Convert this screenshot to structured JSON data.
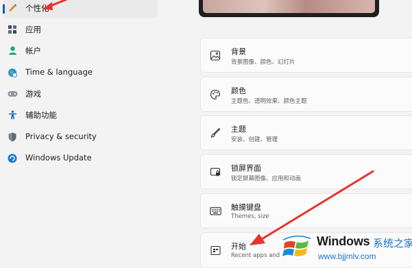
{
  "sidebar": {
    "items": [
      {
        "label": "个性化",
        "icon": "pencil-icon",
        "selected": true
      },
      {
        "label": "应用",
        "icon": "apps-icon"
      },
      {
        "label": "帐户",
        "icon": "person-icon"
      },
      {
        "label": "Time & language",
        "icon": "globe-clock-icon"
      },
      {
        "label": "游戏",
        "icon": "gamepad-icon"
      },
      {
        "label": "辅助功能",
        "icon": "accessibility-icon"
      },
      {
        "label": "Privacy & security",
        "icon": "shield-icon"
      },
      {
        "label": "Windows Update",
        "icon": "update-icon"
      }
    ]
  },
  "main": {
    "cards": [
      {
        "title": "背景",
        "subtitle": "背景图像、颜色、幻灯片",
        "icon": "image-icon"
      },
      {
        "title": "颜色",
        "subtitle": "主题色、透明效果、颜色主题",
        "icon": "palette-icon"
      },
      {
        "title": "主题",
        "subtitle": "安装、创建、管理",
        "icon": "brush-icon"
      },
      {
        "title": "锁屏界面",
        "subtitle": "锁定屏幕图像、应用和动画",
        "icon": "lock-screen-icon"
      },
      {
        "title": "触摸键盘",
        "subtitle": "Themes, size",
        "icon": "keyboard-icon"
      },
      {
        "title": "开始",
        "subtitle": "Recent apps and",
        "icon": "start-icon"
      }
    ]
  },
  "watermark": {
    "title": "Windows",
    "chinese": "系统之家",
    "url": "www.bjjmlv.com"
  },
  "colors": {
    "accent": "#005fb8",
    "arrow": "#e8322b",
    "watermark_blue": "#1a73c8"
  }
}
